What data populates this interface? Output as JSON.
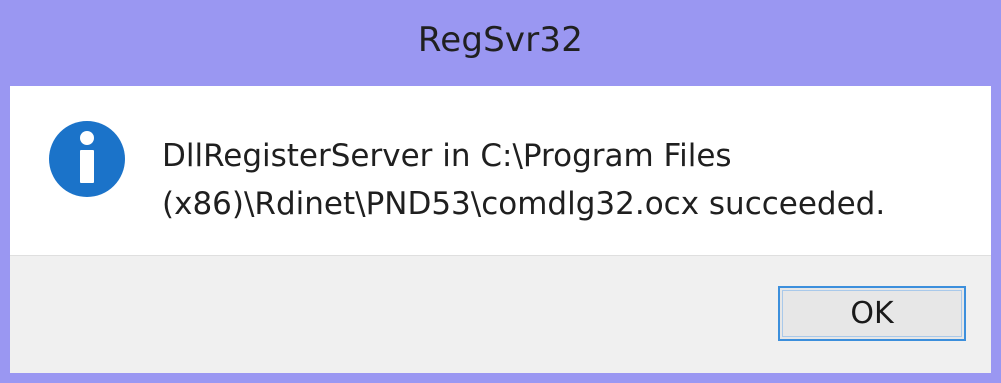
{
  "window": {
    "title": "RegSvr32",
    "border_color": "#9a97f2"
  },
  "message": {
    "icon": "info-icon",
    "lines": [
      "DllRegisterServer in C:\\Program Files",
      "(x86)\\Rdinet\\PND53\\comdlg32.ocx succeeded."
    ]
  },
  "buttons": {
    "ok_label": "OK",
    "ok_focus_color": "#3c8fdc"
  },
  "colors": {
    "icon_blue": "#1b73c9",
    "content_bg": "#ffffff",
    "footer_bg": "#f0f0f0"
  }
}
